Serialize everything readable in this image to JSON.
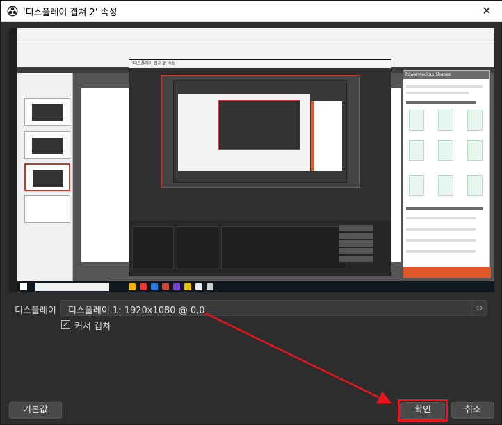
{
  "window": {
    "title": "'디스플레이 캡쳐 2' 속성",
    "close_glyph": "✕"
  },
  "preview": {
    "inner_obs_title": "'디스플레이 캡쳐 2' 속성",
    "shapes_panel_title": "PowerMockup Shapes"
  },
  "form": {
    "display_label": "디스플레이",
    "display_value": "디스플레이 1: 1920x1080 @ 0,0",
    "cursor_capture_label": "커서 캡쳐",
    "cursor_capture_checked": true,
    "checkmark": "✓"
  },
  "buttons": {
    "defaults": "기본값",
    "ok": "확인",
    "cancel": "취소"
  },
  "annotation": {
    "highlight_color": "#e8161c",
    "arrow_color": "#e8161c"
  },
  "icons": {
    "app": "obs-icon",
    "close": "close-icon",
    "combo_arrows": "updown-chevron-icon",
    "check": "checkmark-icon"
  }
}
